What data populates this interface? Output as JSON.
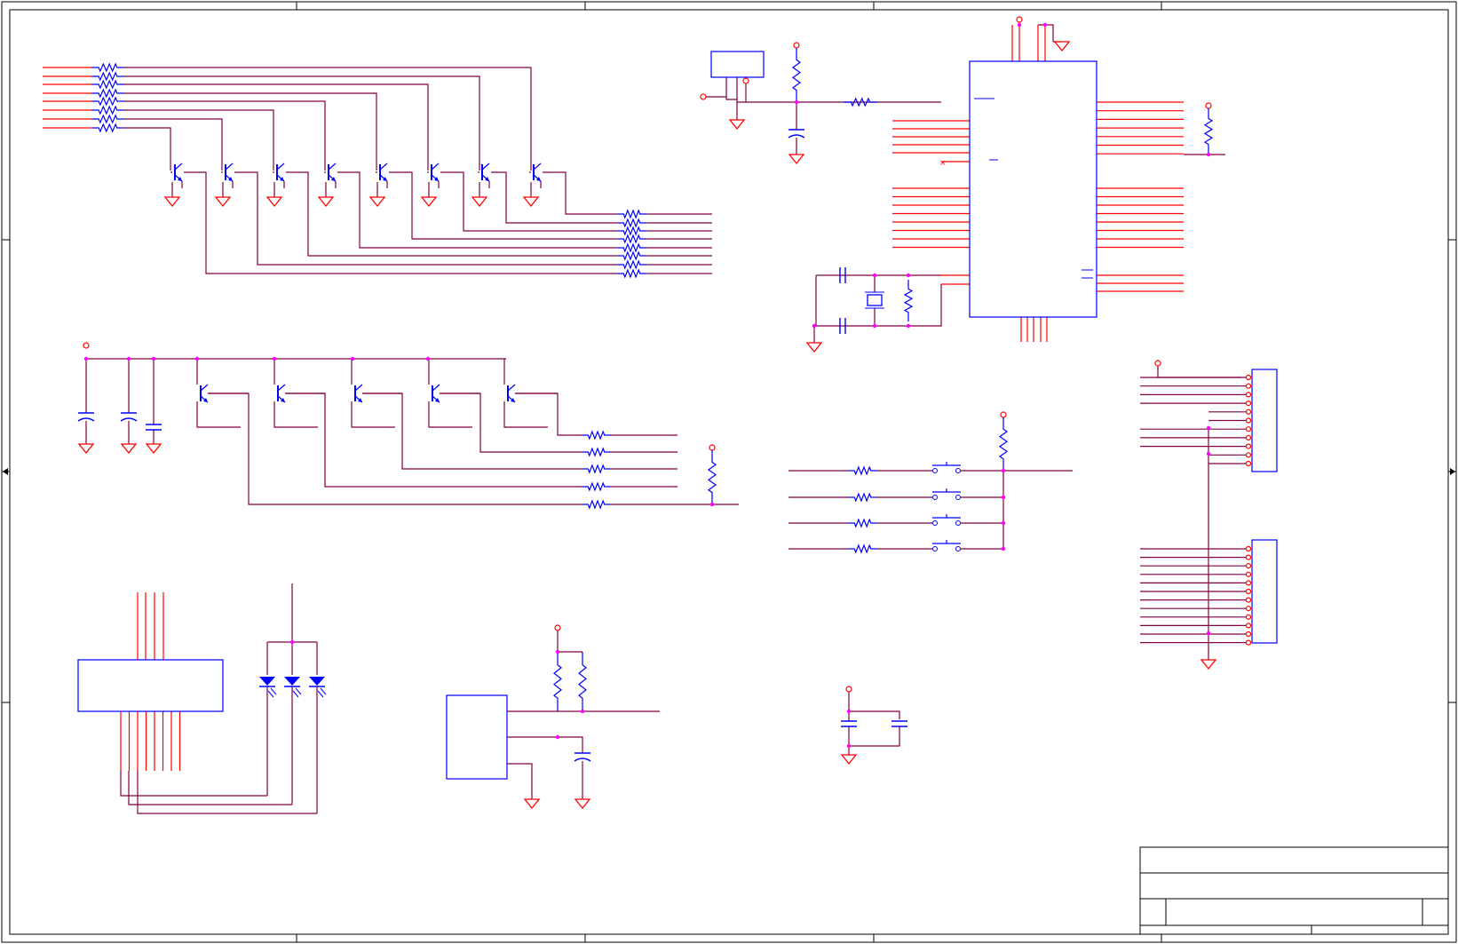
{
  "title": "",
  "colors": {
    "wire": "#800040",
    "pin": "#ff0000",
    "body": "#0000ff",
    "junction": "#ff00ff",
    "frame": "#000000",
    "background": "#ffffff"
  },
  "title_block": {
    "fields": []
  }
}
